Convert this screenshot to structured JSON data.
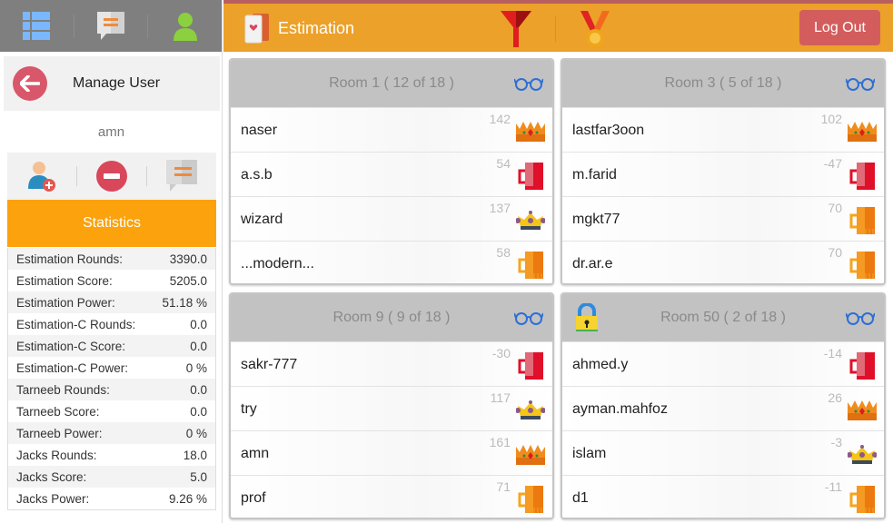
{
  "sidebar": {
    "top_icons": [
      "list-icon",
      "chat-icon",
      "user-icon"
    ],
    "manage_title": "Manage User",
    "username": "amn",
    "action_icons": [
      "add-friend-icon",
      "block-icon",
      "message-icon"
    ],
    "stats_title": "Statistics",
    "stats": [
      {
        "label": "Estimation Rounds:",
        "value": "3390.0"
      },
      {
        "label": "Estimation Score:",
        "value": "5205.0"
      },
      {
        "label": "Estimation Power:",
        "value": "51.18 %"
      },
      {
        "label": "Estimation-C Rounds:",
        "value": "0.0"
      },
      {
        "label": "Estimation-C Score:",
        "value": "0.0"
      },
      {
        "label": "Estimation-C Power:",
        "value": "0 %"
      },
      {
        "label": "Tarneeb Rounds:",
        "value": "0.0"
      },
      {
        "label": "Tarneeb Score:",
        "value": "0.0"
      },
      {
        "label": "Tarneeb Power:",
        "value": "0 %"
      },
      {
        "label": "Jacks Rounds:",
        "value": "18.0"
      },
      {
        "label": "Jacks Score:",
        "value": "5.0"
      },
      {
        "label": "Jacks Power:",
        "value": "9.26 %"
      }
    ]
  },
  "header": {
    "title": "Estimation",
    "logout_label": "Log Out",
    "colors": {
      "bar": "#eca12a",
      "logout": "#d35d5d"
    }
  },
  "rooms": [
    {
      "title": "Room 1 ( 12 of 18 )",
      "locked": false,
      "players": [
        {
          "name": "naser",
          "score": "142",
          "icon": "orange-crown"
        },
        {
          "name": "a.s.b",
          "score": "54",
          "icon": "red-mug"
        },
        {
          "name": "wizard",
          "score": "137",
          "icon": "gold-crown"
        },
        {
          "name": "...modern...",
          "score": "58",
          "icon": "orange-mug"
        }
      ]
    },
    {
      "title": "Room 3 ( 5 of 18 )",
      "locked": false,
      "players": [
        {
          "name": "lastfar3oon",
          "score": "102",
          "icon": "orange-crown"
        },
        {
          "name": "m.farid",
          "score": "-47",
          "icon": "red-mug"
        },
        {
          "name": "mgkt77",
          "score": "70",
          "icon": "orange-mug"
        },
        {
          "name": "dr.ar.e",
          "score": "70",
          "icon": "orange-mug"
        }
      ]
    },
    {
      "title": "Room 9 ( 9 of 18 )",
      "locked": false,
      "players": [
        {
          "name": "sakr-777",
          "score": "-30",
          "icon": "red-mug"
        },
        {
          "name": "try",
          "score": "117",
          "icon": "gold-crown"
        },
        {
          "name": "amn",
          "score": "161",
          "icon": "orange-crown"
        },
        {
          "name": "prof",
          "score": "71",
          "icon": "orange-mug"
        }
      ]
    },
    {
      "title": "Room 50 ( 2 of 18 )",
      "locked": true,
      "players": [
        {
          "name": "ahmed.y",
          "score": "-14",
          "icon": "red-mug"
        },
        {
          "name": "ayman.mahfoz",
          "score": "26",
          "icon": "orange-crown"
        },
        {
          "name": "islam",
          "score": "-3",
          "icon": "gold-crown"
        },
        {
          "name": "d1",
          "score": "-11",
          "icon": "orange-mug"
        }
      ]
    }
  ]
}
